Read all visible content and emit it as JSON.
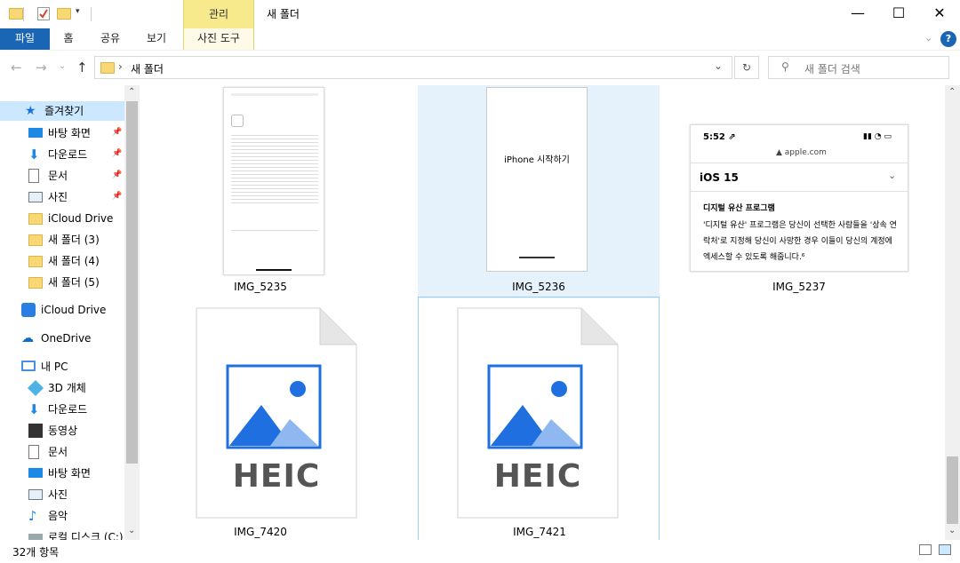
{
  "window": {
    "title": "새 폴더",
    "tool_group": "관리",
    "minimize": "—",
    "maximize": "☐",
    "close": "✕"
  },
  "ribbon": {
    "tabs": [
      "파일",
      "홈",
      "공유",
      "보기",
      "사진 도구"
    ],
    "help": "?"
  },
  "address": {
    "path_sep": "›",
    "path": "새 폴더",
    "search_placeholder": "새 폴더 검색"
  },
  "nav": {
    "quick_access": "즐겨찾기",
    "quick_items": [
      {
        "label": "바탕 화면",
        "icon": "desktop-icon",
        "pinned": true
      },
      {
        "label": "다운로드",
        "icon": "download-icon",
        "pinned": true
      },
      {
        "label": "문서",
        "icon": "document-icon",
        "pinned": true
      },
      {
        "label": "사진",
        "icon": "pictures-icon",
        "pinned": true
      },
      {
        "label": "iCloud Drive",
        "icon": "folder-icon",
        "pinned": false
      },
      {
        "label": "새 폴더 (3)",
        "icon": "folder-icon",
        "pinned": false
      },
      {
        "label": "새 폴더 (4)",
        "icon": "folder-icon",
        "pinned": false
      },
      {
        "label": "새 폴더 (5)",
        "icon": "folder-icon",
        "pinned": false
      }
    ],
    "icloud": "iCloud Drive",
    "onedrive": "OneDrive",
    "this_pc": "내 PC",
    "pc_items": [
      {
        "label": "3D 개체",
        "icon": "3d-objects-icon"
      },
      {
        "label": "다운로드",
        "icon": "download-icon"
      },
      {
        "label": "동영상",
        "icon": "videos-icon"
      },
      {
        "label": "문서",
        "icon": "document-icon"
      },
      {
        "label": "바탕 화면",
        "icon": "desktop-icon"
      },
      {
        "label": "사진",
        "icon": "pictures-icon"
      },
      {
        "label": "음악",
        "icon": "music-icon"
      },
      {
        "label": "로컬 디스크 (C:)",
        "icon": "drive-icon"
      }
    ]
  },
  "files": [
    {
      "name": "IMG_5235",
      "kind": "screenshot-article"
    },
    {
      "name": "IMG_5236",
      "kind": "screenshot-iphone",
      "selected": true,
      "caption": "iPhone 시작하기"
    },
    {
      "name": "IMG_5237",
      "kind": "screenshot-web",
      "time": "5:52 ⇗",
      "url": "▲ apple.com",
      "heading": "iOS 15",
      "sub": "디지털 유산 프로그램",
      "body": "'디지털 유산' 프로그램은 당신이 선택한 사람들을 '상속 연락처'로 지정해 당신이 사망한 경우 이들이 당신의 계정에 엑세스할 수 있도록 해줍니다.⁶"
    },
    {
      "name": "IMG_7420",
      "kind": "heic",
      "label": "HEIC"
    },
    {
      "name": "IMG_7421",
      "kind": "heic",
      "label": "HEIC",
      "hover": true
    }
  ],
  "status": {
    "count": "32개 항목"
  },
  "colors": {
    "file_tab": "#1a66b5",
    "tool_tab": "#f6ea8c",
    "selected_bg": "#e5f1fb",
    "heic_blue": "#1f6fe0"
  }
}
